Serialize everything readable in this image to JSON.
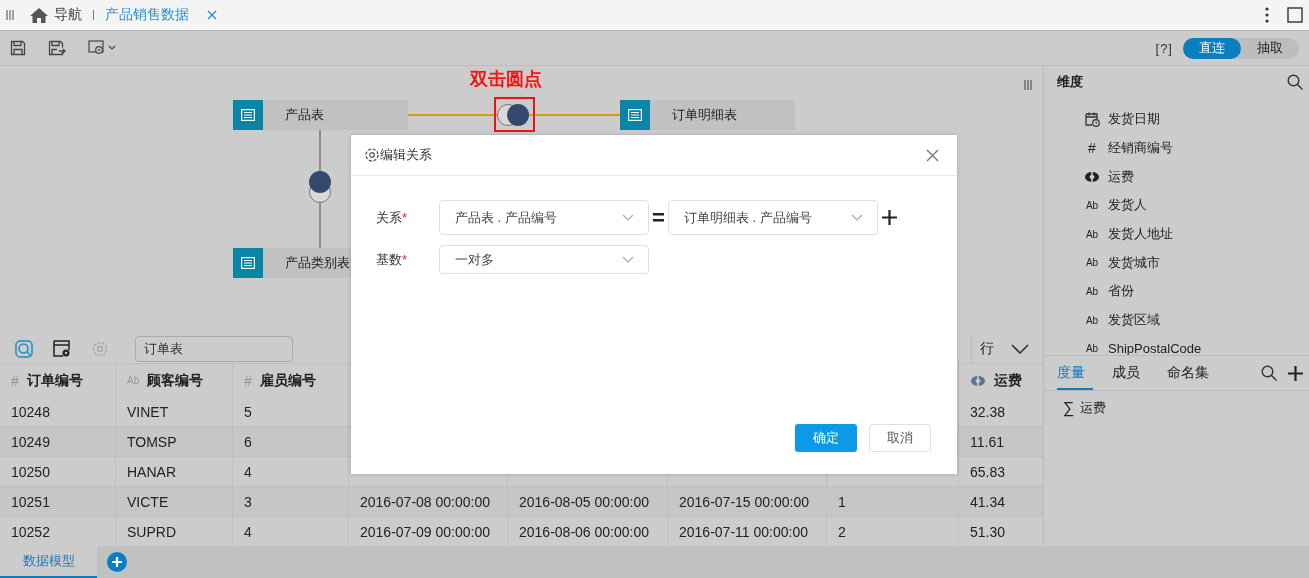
{
  "top_bar": {
    "tabs": [
      {
        "label": "导航",
        "kind": "home",
        "selected": false,
        "closable": false
      },
      {
        "label": "产品销售数据",
        "kind": "doc",
        "selected": true,
        "closable": true
      }
    ]
  },
  "toolbar": {
    "help": "[?]",
    "mode_toggle": [
      {
        "label": "直连",
        "selected": true
      },
      {
        "label": "抽取",
        "selected": false
      }
    ]
  },
  "diagram": {
    "hint": "双击圆点",
    "nodes": [
      {
        "label": "产品表"
      },
      {
        "label": "订单明细表"
      },
      {
        "label": "产品类别表"
      }
    ]
  },
  "table_panel": {
    "table_name": "订单表",
    "axis_label": "行",
    "columns": [
      {
        "label": "订单编号",
        "glyph": "#",
        "kind": "number"
      },
      {
        "label": "顾客编号",
        "glyph": "Ab",
        "kind": "text"
      },
      {
        "label": "雇员编号",
        "glyph": "#",
        "kind": "number"
      },
      null,
      null,
      null,
      null,
      {
        "label": "运费",
        "kind": "geo"
      }
    ],
    "rows": [
      {
        "cells": [
          "10248",
          "VINET",
          "5",
          null,
          null,
          null,
          null,
          "32.38"
        ]
      },
      {
        "cells": [
          "10249",
          "TOMSP",
          "6",
          null,
          null,
          null,
          null,
          "11.61"
        ]
      },
      {
        "cells": [
          "10250",
          "HANAR",
          "4",
          null,
          null,
          null,
          null,
          "65.83"
        ]
      },
      {
        "cells": [
          "10251",
          "VICTE",
          "3",
          "2016-07-08 00:00:00",
          "2016-08-05 00:00:00",
          "2016-07-15 00:00:00",
          "1",
          "41.34"
        ]
      },
      {
        "cells": [
          "10252",
          "SUPRD",
          "4",
          "2016-07-09 00:00:00",
          "2016-08-06 00:00:00",
          "2016-07-11 00:00:00",
          "2",
          "51.30"
        ]
      }
    ]
  },
  "dimensions": {
    "title": "维度",
    "items": [
      {
        "label": "发货日期",
        "kind": "date"
      },
      {
        "label": "经销商编号",
        "kind": "number",
        "glyph": "#"
      },
      {
        "label": "运费",
        "kind": "geo"
      },
      {
        "label": "发货人",
        "kind": "text",
        "glyph": "Ab"
      },
      {
        "label": "发货人地址",
        "kind": "text",
        "glyph": "Ab"
      },
      {
        "label": "发货城市",
        "kind": "text",
        "glyph": "Ab"
      },
      {
        "label": "省份",
        "kind": "text",
        "glyph": "Ab"
      },
      {
        "label": "发货区域",
        "kind": "text",
        "glyph": "Ab"
      },
      {
        "label": "ShipPostalCode",
        "kind": "text",
        "glyph": "Ab"
      }
    ]
  },
  "measures": {
    "tabs": [
      {
        "label": "度量",
        "selected": true
      },
      {
        "label": "成员",
        "selected": false
      },
      {
        "label": "命名集",
        "selected": false
      }
    ],
    "items": [
      {
        "symbol": "∑",
        "label": "运费"
      }
    ]
  },
  "dialog": {
    "title": "编辑关系",
    "fields": [
      {
        "label": "关系",
        "mark": "*",
        "values": [
          "产品表 . 产品编号",
          "订单明细表 . 产品编号"
        ],
        "operator": "=",
        "addable": true
      },
      {
        "label": "基数",
        "mark": "*",
        "values": [
          "一对多"
        ],
        "addable": false
      }
    ],
    "buttons": [
      {
        "label": "确定",
        "kind": "primary"
      },
      {
        "label": "取消",
        "kind": "secondary"
      }
    ]
  },
  "bottom_bar": {
    "tabs": [
      {
        "label": "数据模型",
        "selected": true
      }
    ]
  }
}
